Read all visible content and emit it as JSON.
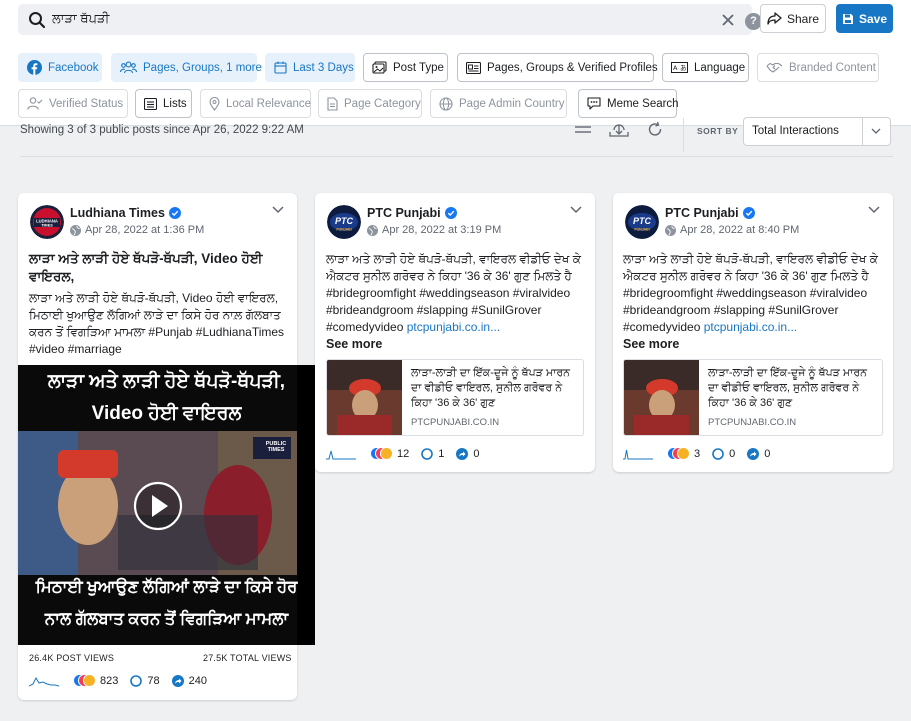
{
  "search": {
    "query": "ਲਾੜਾ ਥੱਪੜੀ",
    "share_label": "Share",
    "save_label": "Save"
  },
  "filters": {
    "row1": [
      {
        "label": "Facebook",
        "icon": "facebook-icon",
        "state": "active"
      },
      {
        "label": "Pages, Groups, 1 more",
        "icon": "groups-icon",
        "state": "active"
      },
      {
        "label": "Last 3 Days",
        "icon": "calendar-icon",
        "state": "active"
      },
      {
        "label": "Post Type",
        "icon": "post-type-icon",
        "state": "outline"
      },
      {
        "label": "Pages, Groups & Verified Profiles",
        "icon": "profiles-icon",
        "state": "outline"
      },
      {
        "label": "Language",
        "icon": "language-icon",
        "state": "outline"
      },
      {
        "label": "Branded Content",
        "icon": "handshake-icon",
        "state": "disabled"
      }
    ],
    "row2": [
      {
        "label": "Verified Status",
        "icon": "user-check-icon",
        "state": "disabled"
      },
      {
        "label": "Lists",
        "icon": "list-icon",
        "state": "outline"
      },
      {
        "label": "Local Relevance",
        "icon": "location-pin-icon",
        "state": "disabled"
      },
      {
        "label": "Page Category",
        "icon": "document-icon",
        "state": "disabled"
      },
      {
        "label": "Page Admin Country",
        "icon": "globe-icon",
        "state": "disabled"
      },
      {
        "label": "Meme Search",
        "icon": "meme-icon",
        "state": "outline"
      }
    ]
  },
  "summary": {
    "text": "Showing 3 of 3 public posts since Apr 26, 2022 9:22 AM"
  },
  "sort": {
    "label": "SORT BY",
    "value": "Total Interactions"
  },
  "posts": [
    {
      "page": "Ludhiana Times",
      "date": "Apr 28, 2022 at 1:36 PM",
      "headline": "ਲਾੜਾ ਅਤੇ ਲਾੜੀ ਹੋਏ ਥੱਪੜੋ-ਥੱਪੜੀ, Video ਹੋਈ ਵਾਇਰਲ,",
      "body": "ਲਾੜਾ ਅਤੇ ਲਾੜੀ ਹੋਏ ਥੱਪੜੋ-ਥੱਪੜੀ, Video ਹੋਈ ਵਾਇਰਲ, ਮਿਠਾਈ ਖੁਆਉਣ ਲੱਗਿਆਂ ਲਾੜੇ ਦਾ ਕਿਸੇ ਹੋਰ ਨਾਲ਼ ਗੱਲਬਾਤ ਕਰਨ ਤੋਂ ਵਿਗੜਿਆ ਮਾਮਲਾ #Punjab #LudhianaTimes #video #marriage",
      "video_top_line1": "ਲਾੜਾ ਅਤੇ ਲਾੜੀ ਹੋਏ ਥੱਪੜੋ-ਥੱਪੜੀ,",
      "video_top_line2": "Video ਹੋਈ ਵਾਇਰਲ",
      "video_bottom_line1": "ਮਿਠਾਈ ਖੁਆਉਣ ਲੱਗਿਆਂ ਲਾੜੇ ਦਾ ਕਿਸੇ ਹੋਰ",
      "video_bottom_line2": "ਨਾਲ ਗੱਲਬਾਤ ਕਰਨ ਤੋਂ ਵਿਗੜਿਆ ਮਾਮਲਾ",
      "video_badge_line1": "PUBLIC",
      "video_badge_line2": "TIMES",
      "post_views": "26.4K POST VIEWS",
      "total_views": "27.5K TOTAL VIEWS",
      "reactions": "823",
      "comments": "78",
      "shares": "240"
    },
    {
      "page": "PTC Punjabi",
      "date": "Apr 28, 2022 at 3:19 PM",
      "body_text": "ਲਾੜਾ ਅਤੇ ਲਾੜੀ ਹੋਏ ਥੱਪੜੋ-ਥੱਪੜੀ, ਵਾਇਰਲ ਵੀਡੀਓ ਦੇਖ ਕੇ ਐਕਟਰ ਸੁਨੀਲ ਗਰੋਵਰ ਨੇ ਕਿਹਾ '36 ਕੇ 36' ਗੁਣ ਮਿਲਤੇ ਹੈ #bridegroomfight #weddingseason #viralvideo #brideandgroom #slapping #SunilGrover #comedyvideo ",
      "body_link": "ptcpunjabi.co.in...",
      "see_more": "See more",
      "link_title": "ਲਾੜਾ-ਲਾੜੀ ਦਾ ਇੱਕ-ਦੂਜੇ ਨੂੰ ਥੱਪੜ ਮਾਰਨ ਦਾ ਵੀਡੀਓ ਵਾਇਰਲ, ਸੁਨੀਲ ਗਰੋਵਰ ਨੇ ਕਿਹਾ '36 ਕੇ 36' ਗੁਣ",
      "link_domain": "PTCPUNJABI.CO.IN",
      "reactions": "12",
      "comments": "1",
      "shares": "0"
    },
    {
      "page": "PTC Punjabi",
      "date": "Apr 28, 2022 at 8:40 PM",
      "body_text": "ਲਾੜਾ ਅਤੇ ਲਾੜੀ ਹੋਏ ਥੱਪੜੋ-ਥੱਪੜੀ, ਵਾਇਰਲ ਵੀਡੀਓ ਦੇਖ ਕੇ ਐਕਟਰ ਸੁਨੀਲ ਗਰੋਵਰ ਨੇ ਕਿਹਾ '36 ਕੇ 36' ਗੁਣ ਮਿਲਤੇ ਹੈ #bridegroomfight #weddingseason #viralvideo #brideandgroom #slapping #SunilGrover #comedyvideo ",
      "body_link": "ptcpunjabi.co.in...",
      "see_more": "See more",
      "link_title": "ਲਾੜਾ-ਲਾੜੀ ਦਾ ਇੱਕ-ਦੂਜੇ ਨੂੰ ਥੱਪੜ ਮਾਰਨ ਦਾ ਵੀਡੀਓ ਵਾਇਰਲ, ਸੁਨੀਲ ਗਰੋਵਰ ਨੇ ਕਿਹਾ '36 ਕੇ 36' ਗੁਣ",
      "link_domain": "PTCPUNJABI.CO.IN",
      "reactions": "3",
      "comments": "0",
      "shares": "0"
    }
  ],
  "avatars": {
    "ludhiana_line1": "LUDHIANA",
    "ludhiana_line2": "TIMES",
    "ptc": "PTC",
    "ptc_sub": "PUNJABI"
  },
  "colors": {
    "accent": "#1877c4",
    "chip_active_bg": "#e7f1fb",
    "like": "#1877f2",
    "love": "#f33e58",
    "haha": "#f7b125"
  }
}
